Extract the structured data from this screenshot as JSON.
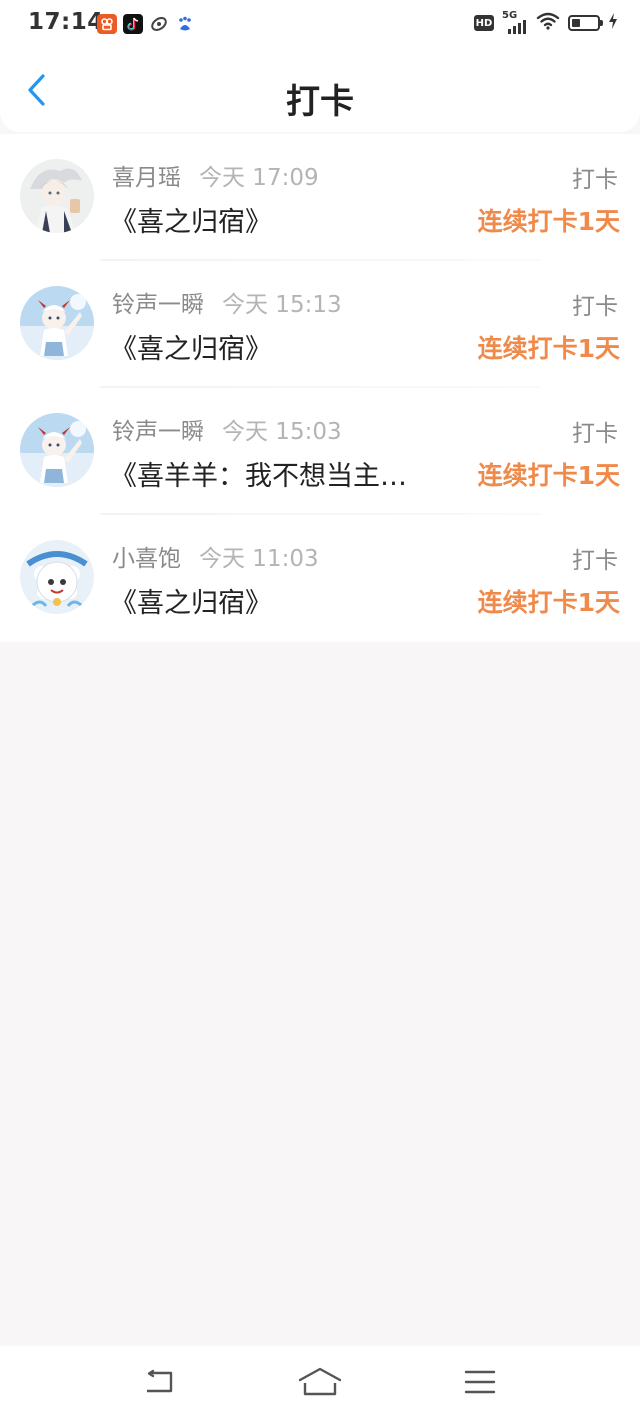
{
  "status_bar": {
    "time": "17:14",
    "notification_icons": [
      "kuaishou-icon",
      "douyin-icon",
      "browser-icon",
      "baidu-icon"
    ],
    "hd_label": "HD",
    "network_label": "5G",
    "battery_level_fraction": 0.35
  },
  "header": {
    "title": "打卡",
    "back_icon": "chevron-left-icon",
    "accent_color": "#2196f3"
  },
  "checkins": [
    {
      "user": "喜月瑶",
      "time": "今天 17:09",
      "title": "《喜之归宿》",
      "action": "打卡",
      "streak": "连续打卡1天",
      "avatar": "avatar-1"
    },
    {
      "user": "铃声一瞬",
      "time": "今天 15:13",
      "title": "《喜之归宿》",
      "action": "打卡",
      "streak": "连续打卡1天",
      "avatar": "avatar-2"
    },
    {
      "user": "铃声一瞬",
      "time": "今天 15:03",
      "title": "《喜羊羊：我不想当主…",
      "action": "打卡",
      "streak": "连续打卡1天",
      "avatar": "avatar-2"
    },
    {
      "user": "小喜饱",
      "time": "今天 11:03",
      "title": "《喜之归宿》",
      "action": "打卡",
      "streak": "连续打卡1天",
      "avatar": "avatar-3"
    }
  ],
  "colors": {
    "streak": "#f08a4b",
    "background": "#f8f6f7"
  },
  "bottom_nav": [
    "back-icon",
    "home-icon",
    "menu-icon"
  ]
}
